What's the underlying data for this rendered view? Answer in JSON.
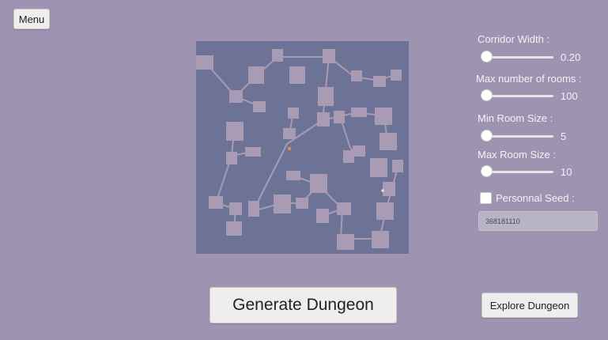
{
  "menu": {
    "label": "Menu"
  },
  "settings": {
    "corridor_width": {
      "label": "Corridor Width :",
      "value": "0.20",
      "fraction": 0.0
    },
    "max_rooms": {
      "label": "Max number of rooms :",
      "value": "100",
      "fraction": 0.0
    },
    "min_room_size": {
      "label": "Min Room Size :",
      "value": "5",
      "fraction": 0.0
    },
    "max_room_size": {
      "label": "Max Room Size :",
      "value": "10",
      "fraction": 0.0
    },
    "personal_seed": {
      "label": "Personnal Seed :",
      "checked": false,
      "value": "368181110"
    }
  },
  "actions": {
    "generate_label": "Generate Dungeon",
    "explore_label": "Explore Dungeon"
  },
  "colors": {
    "background": "#9e93b0",
    "map": "#6c7396",
    "room": "#a89bb3",
    "player": "#e09040"
  }
}
